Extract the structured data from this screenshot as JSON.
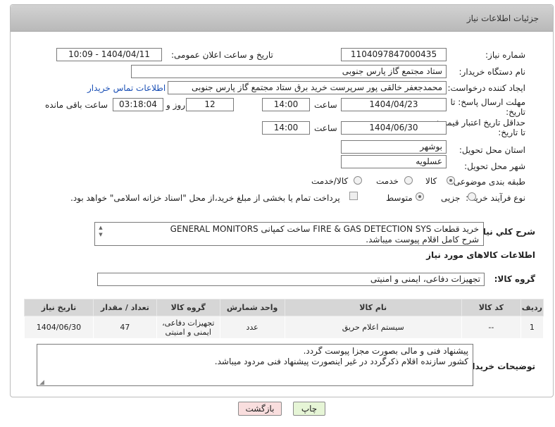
{
  "header": {
    "title": "جزئیات اطلاعات نیاز"
  },
  "fields": {
    "need_number_label": "شماره نیاز:",
    "need_number": "1104097847000435",
    "announce_label": "تاریخ و ساعت اعلان عمومی:",
    "announce_value": "1404/04/11 - 10:09",
    "buyer_org_label": "نام دستگاه خریدار:",
    "buyer_org": "ستاد مجتمع گاز پارس جنوبی",
    "creator_label": "ایجاد کننده درخواست:",
    "creator": "محمدجعفر خالقی پور سرپرست خرید برق ستاد مجتمع گاز پارس جنوبی",
    "contact_link": "اطلاعات تماس خریدار",
    "deadline_label_1": "مهلت ارسال پاسخ: تا",
    "deadline_label_2": "تاریخ:",
    "deadline_date": "1404/04/23",
    "time_label": "ساعت",
    "deadline_time": "14:00",
    "days_value": "12",
    "days_label": "روز و",
    "remaining_time": "03:18:04",
    "remaining_label": "ساعت باقی مانده",
    "price_valid_label_1": "حداقل تاریخ اعتبار قیمت:",
    "price_valid_label_2": "تا تاریخ:",
    "price_valid_date": "1404/06/30",
    "price_valid_time": "14:00",
    "province_label": "استان محل تحویل:",
    "province": "بوشهر",
    "city_label": "شهر محل تحویل:",
    "city": "عسلویه",
    "category_label": "طبقه بندی موضوعی:",
    "category_options": [
      "کالا",
      "خدمت",
      "کالا/خدمت"
    ],
    "process_label": "نوع فرآیند خرید :",
    "process_options": [
      "جزیی",
      "متوسط"
    ],
    "payment_note": "پرداخت تمام یا بخشی از مبلغ خرید،از محل \"اسناد خزانه اسلامی\" خواهد بود."
  },
  "description": {
    "label": "شرح کلي نياز:",
    "line1": "خرید قطعات FIRE & GAS DETECTION SYS  ساخت کمپانی GENERAL MONITORS",
    "line2": "شرح کامل اقلام پیوست میباشد."
  },
  "goods_info_title": "اطلاعات کالاهای مورد نیاز",
  "goods_group": {
    "label": "گروه کالا:",
    "value": "تجهیزات دفاعی، ایمنی و امنیتی"
  },
  "table": {
    "headers": [
      "ردیف",
      "کد کالا",
      "نام کالا",
      "واحد شمارش",
      "گروه کالا",
      "تعداد / مقدار",
      "تاریخ نیاز"
    ],
    "rows": [
      [
        "1",
        "--",
        "سیستم اعلام حریق",
        "عدد",
        "تجهیزات دفاعی، ایمنی و امنیتی",
        "47",
        "1404/06/30"
      ]
    ]
  },
  "buyer_notes": {
    "label": "توضیحات خریدار:",
    "line1": "پیشنهاد فنی و مالی بصورت مجزا پیوست گردد.",
    "line2": "کشور سازنده اقلام ذکرگردد در غیر اینصورت پیشنهاد فنی مردود میباشد."
  },
  "buttons": {
    "print": "چاپ",
    "back": "بازگشت"
  },
  "colors": {
    "link": "#1a4fb5",
    "header_bg": "#c4c4c4",
    "print_bg": "#e6f5d6",
    "back_bg": "#f9dede"
  }
}
